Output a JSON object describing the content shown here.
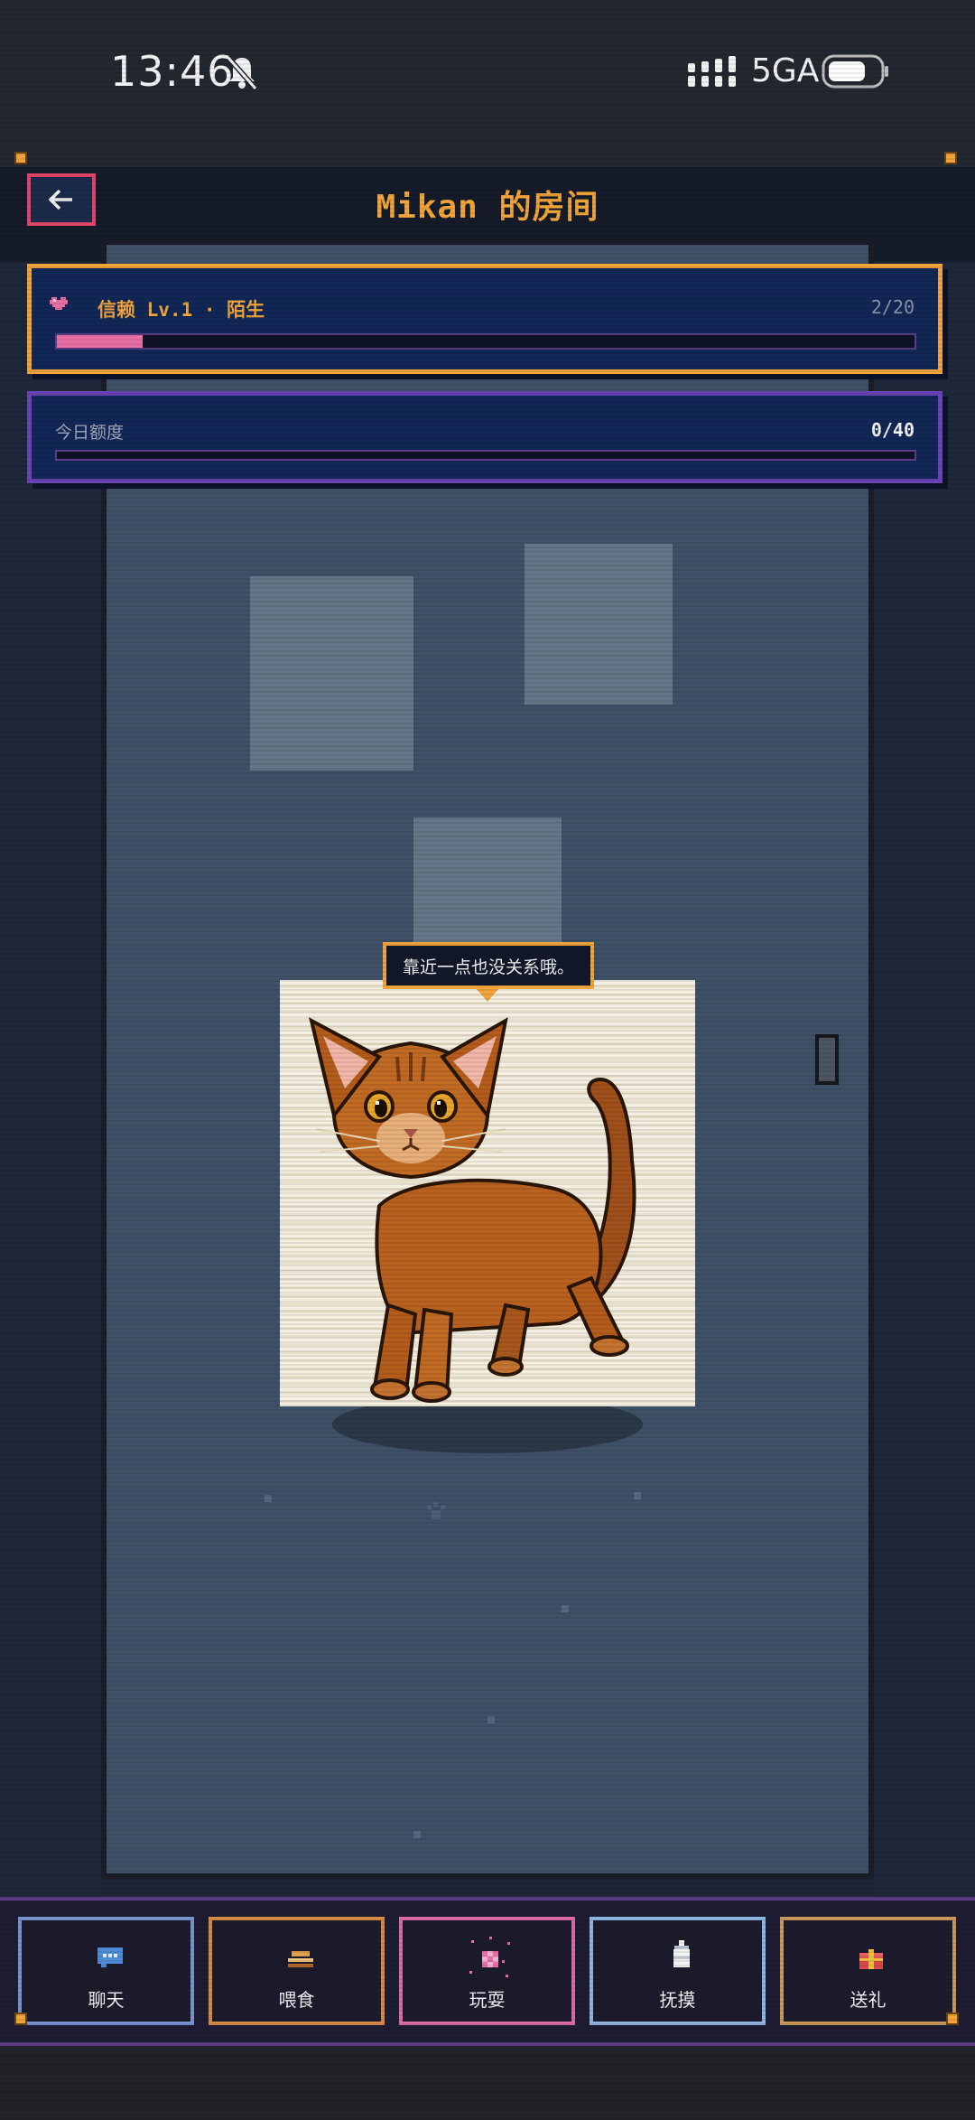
{
  "status_bar": {
    "time": "13:46",
    "network": "5GA"
  },
  "header": {
    "title": "Mikan 的房间",
    "back_icon": "arrow-left-icon"
  },
  "trust": {
    "heart_icon": "pixel-heart-icon",
    "label": "信赖 Lv.1 · 陌生",
    "count": "2/20",
    "progress": 0.1
  },
  "quota": {
    "label": "今日额度",
    "count": "0/40",
    "progress": 0
  },
  "cat": {
    "speech": "靠近一点也没关系哦。"
  },
  "actions": [
    {
      "label": "聊天",
      "icon": "chat-bubble-icon",
      "color": "#7a93cf"
    },
    {
      "label": "喂食",
      "icon": "food-bowl-icon",
      "color": "#d68a45"
    },
    {
      "label": "玩耍",
      "icon": "toy-ball-icon",
      "color": "#d96ca3"
    },
    {
      "label": "抚摸",
      "icon": "hand-icon",
      "color": "#8fb4e0"
    },
    {
      "label": "送礼",
      "icon": "gift-icon",
      "color": "#c9985a"
    }
  ],
  "colors": {
    "accent": "#f0a43a",
    "alert": "#e1456a",
    "panel": "#112756"
  }
}
